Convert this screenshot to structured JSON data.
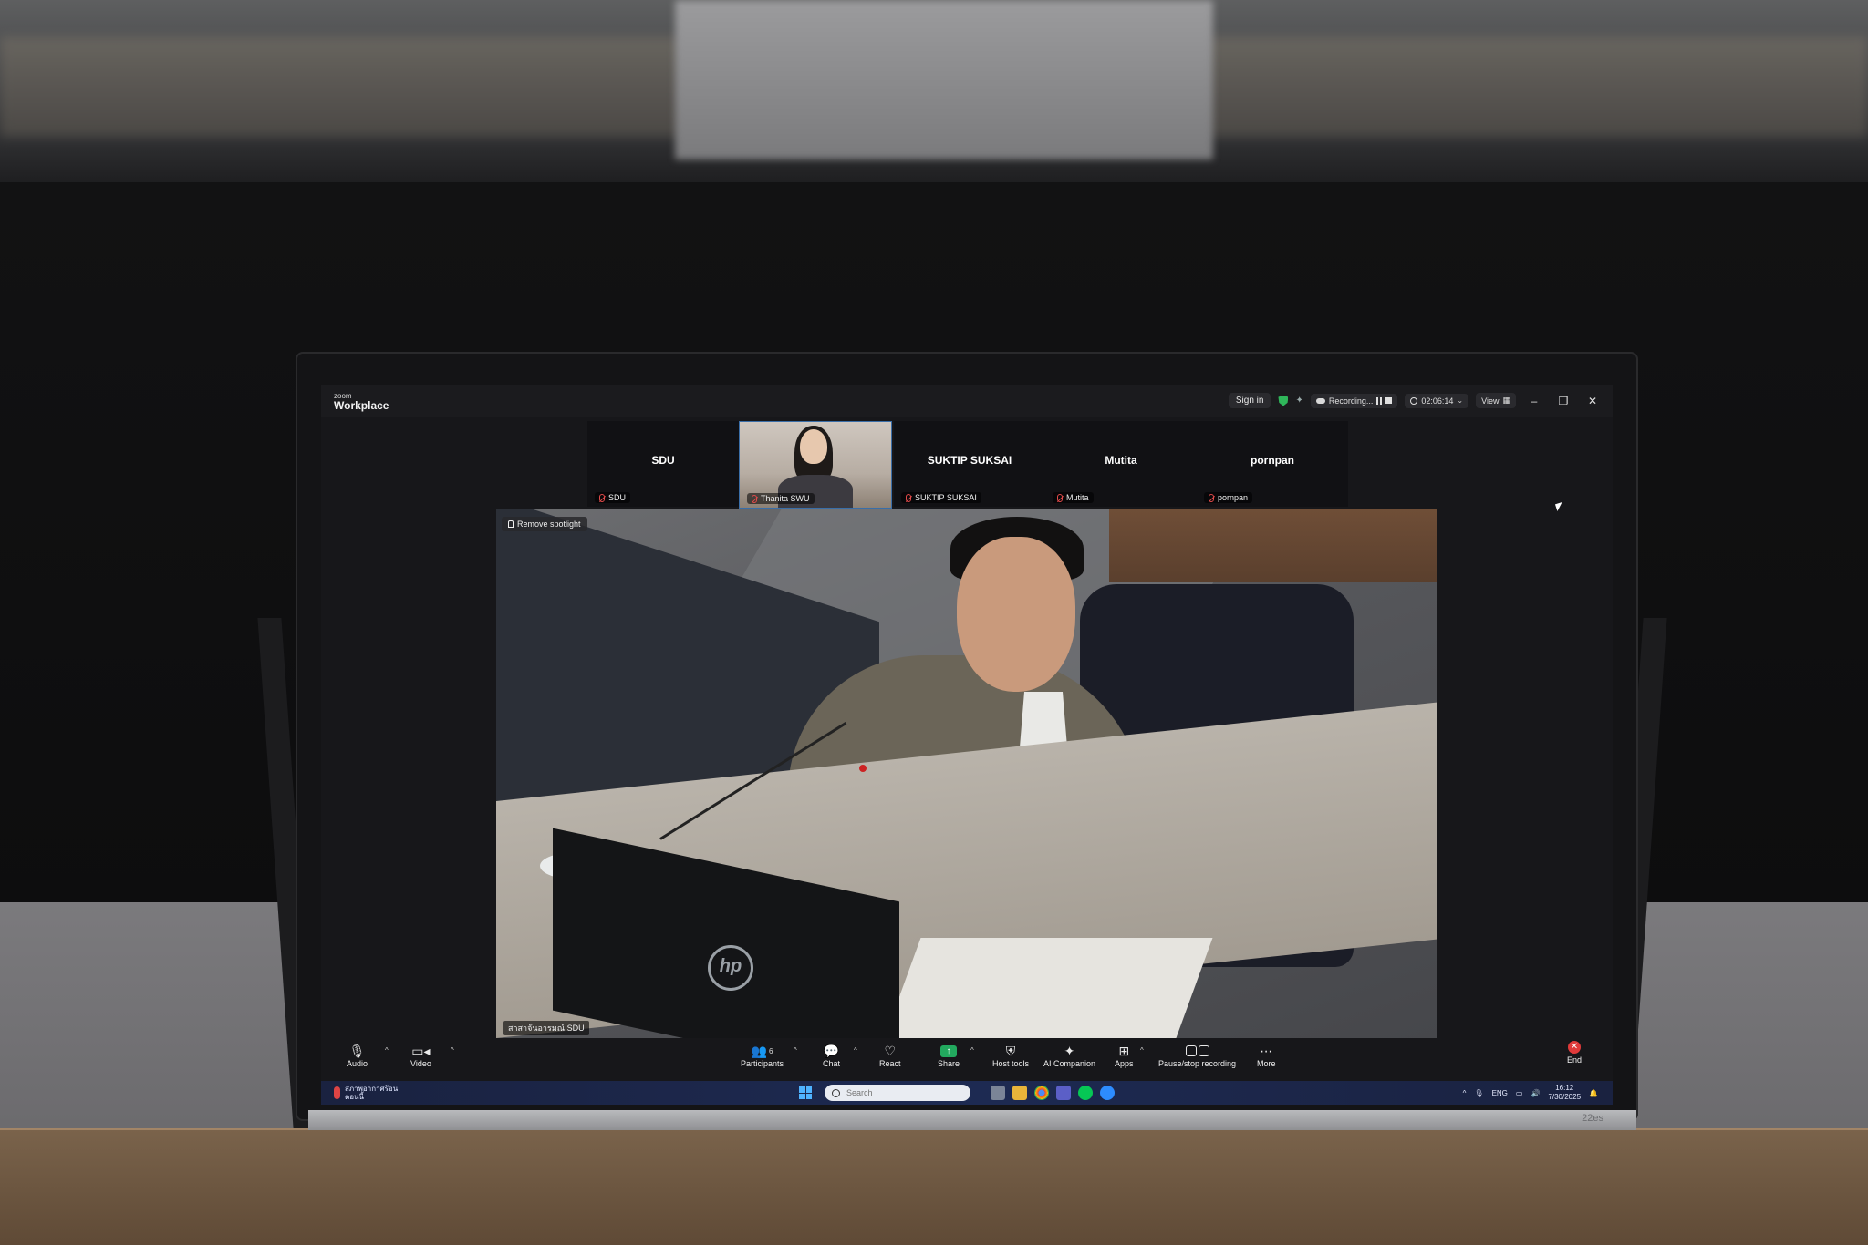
{
  "titlebar": {
    "logo_small": "zoom",
    "logo_big": "Workplace",
    "sign_in": "Sign in",
    "recording_label": "Recording...",
    "timer": "02:06:14",
    "view_label": "View",
    "minimize": "–",
    "restore": "❐",
    "close": "✕"
  },
  "gallery": {
    "tiles": [
      {
        "name": "SDU",
        "label": "SDU"
      },
      {
        "name": "",
        "label": "Thanita SWU"
      },
      {
        "name": "SUKTIP SUKSAI",
        "label": "SUKTIP SUKSAI"
      },
      {
        "name": "Mutita",
        "label": "Mutita"
      },
      {
        "name": "pornpan",
        "label": "pornpan"
      }
    ]
  },
  "main_video": {
    "spotlight_button": "Remove spotlight",
    "speaker_label": "สาสาจันอารมณ์ SDU",
    "laptop_logo": "hp"
  },
  "toolbar": {
    "audio": "Audio",
    "video": "Video",
    "participants": "Participants",
    "participants_count": "6",
    "chat": "Chat",
    "react": "React",
    "share": "Share",
    "host_tools": "Host tools",
    "ai_companion": "AI Companion",
    "apps": "Apps",
    "pause_stop_recording": "Pause/stop recording",
    "more": "More",
    "end": "End"
  },
  "taskbar": {
    "weather_line1": "สภาพอากาศร้อน",
    "weather_line2": "ตอนนี้",
    "search_placeholder": "Search",
    "language": "ENG",
    "time": "16:12",
    "date": "7/30/2025"
  },
  "monitor": {
    "brand": "22es"
  },
  "colors": {
    "accent_green": "#22a95e",
    "end_red": "#e03a3a",
    "taskbar_blue": "#1d2a52"
  }
}
